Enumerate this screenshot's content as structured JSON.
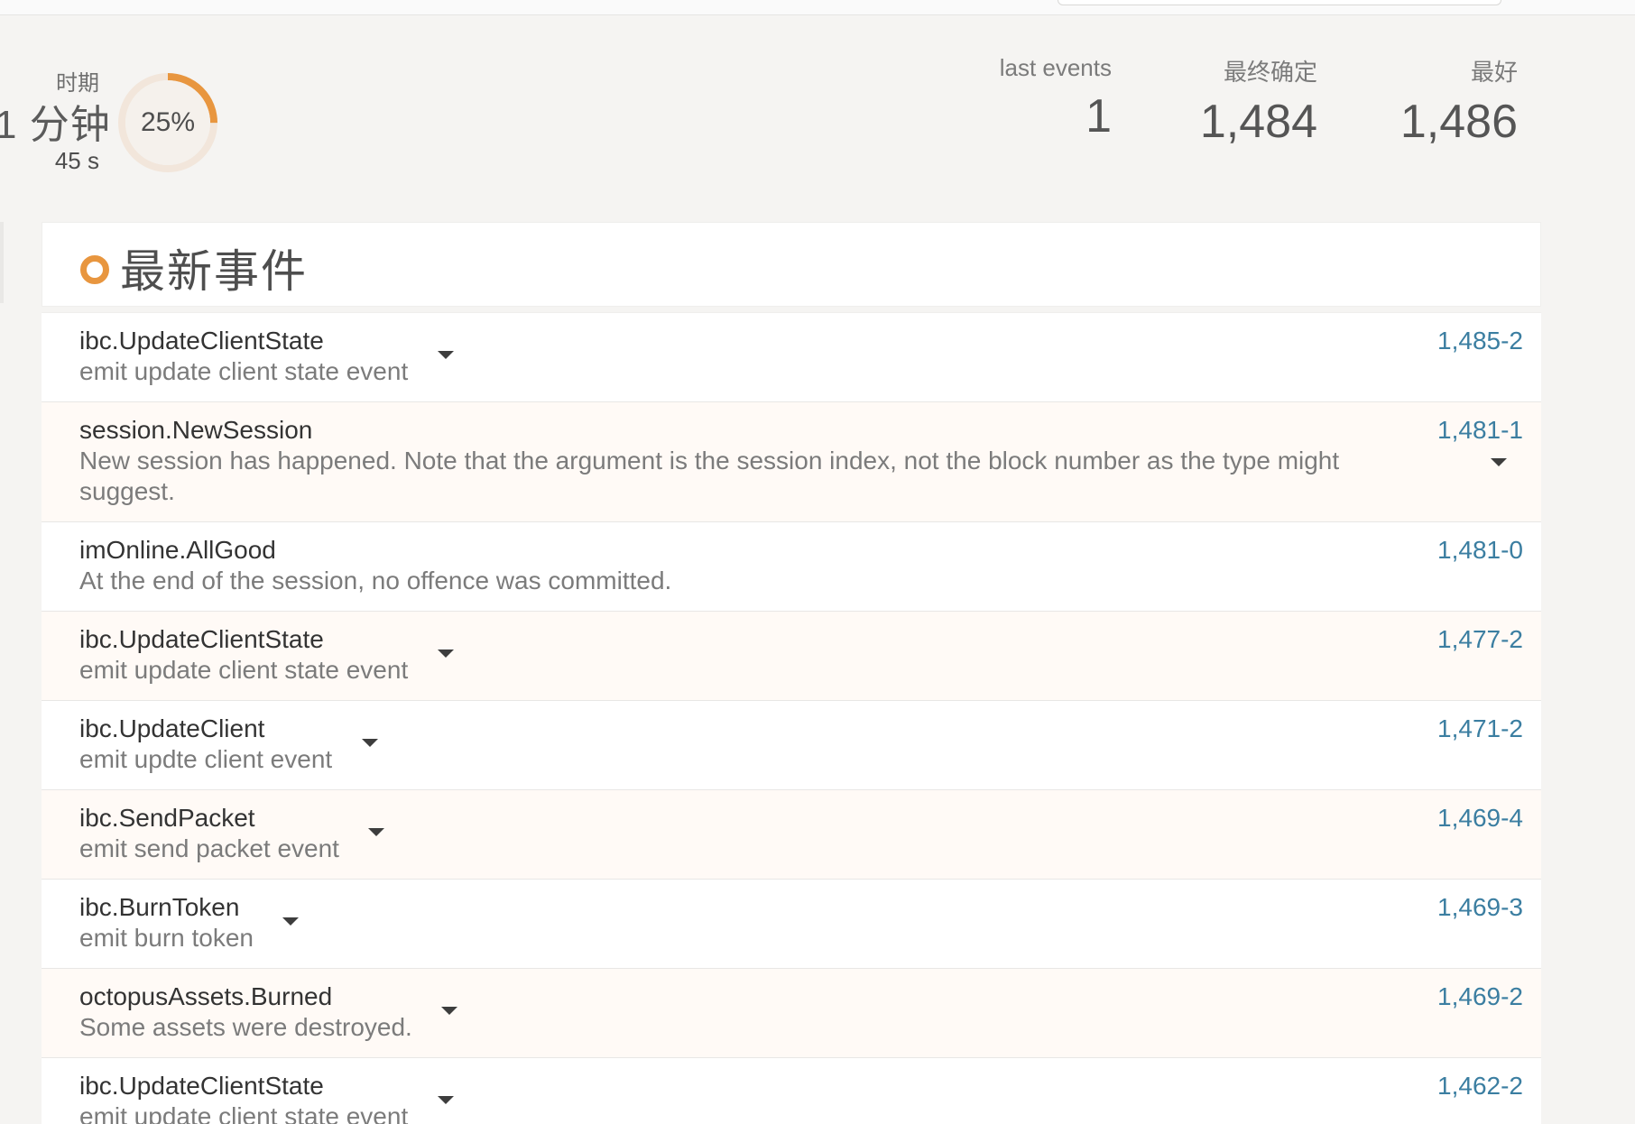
{
  "summary": {
    "period": {
      "label": "时期",
      "value": "1 分钟",
      "sub": "45 s",
      "progress_percent": 25,
      "progress_text": "25%"
    },
    "stats": [
      {
        "label": "last events",
        "value": "1"
      },
      {
        "label": "最终确定",
        "value": "1,484"
      },
      {
        "label": "最好",
        "value": "1,486"
      }
    ]
  },
  "events": {
    "title": "最新事件",
    "rows": [
      {
        "name": "ibc.UpdateClientState",
        "desc": "emit update client state event",
        "block": "1,485-2",
        "expandable": true
      },
      {
        "name": "session.NewSession",
        "desc": "New session has happened. Note that the argument is the session index, not the block number as the type might suggest.",
        "block": "1,481-1",
        "expandable": true
      },
      {
        "name": "imOnline.AllGood",
        "desc": "At the end of the session, no offence was committed.",
        "block": "1,481-0",
        "expandable": false
      },
      {
        "name": "ibc.UpdateClientState",
        "desc": "emit update client state event",
        "block": "1,477-2",
        "expandable": true
      },
      {
        "name": "ibc.UpdateClient",
        "desc": "emit updte client event",
        "block": "1,471-2",
        "expandable": true
      },
      {
        "name": "ibc.SendPacket",
        "desc": "emit send packet event",
        "block": "1,469-4",
        "expandable": true
      },
      {
        "name": "ibc.BurnToken",
        "desc": "emit burn token",
        "block": "1,469-3",
        "expandable": true
      },
      {
        "name": "octopusAssets.Burned",
        "desc": "Some assets were destroyed.",
        "block": "1,469-2",
        "expandable": true
      },
      {
        "name": "ibc.UpdateClientState",
        "desc": "emit update client state event",
        "block": "1,462-2",
        "expandable": true
      }
    ]
  },
  "colors": {
    "accent": "#e8963f",
    "link": "#3b7ea1",
    "progress_track": "#f2e6db"
  },
  "icons": {
    "expand": "chevron-down-icon",
    "header_marker": "circle-dot-icon"
  }
}
